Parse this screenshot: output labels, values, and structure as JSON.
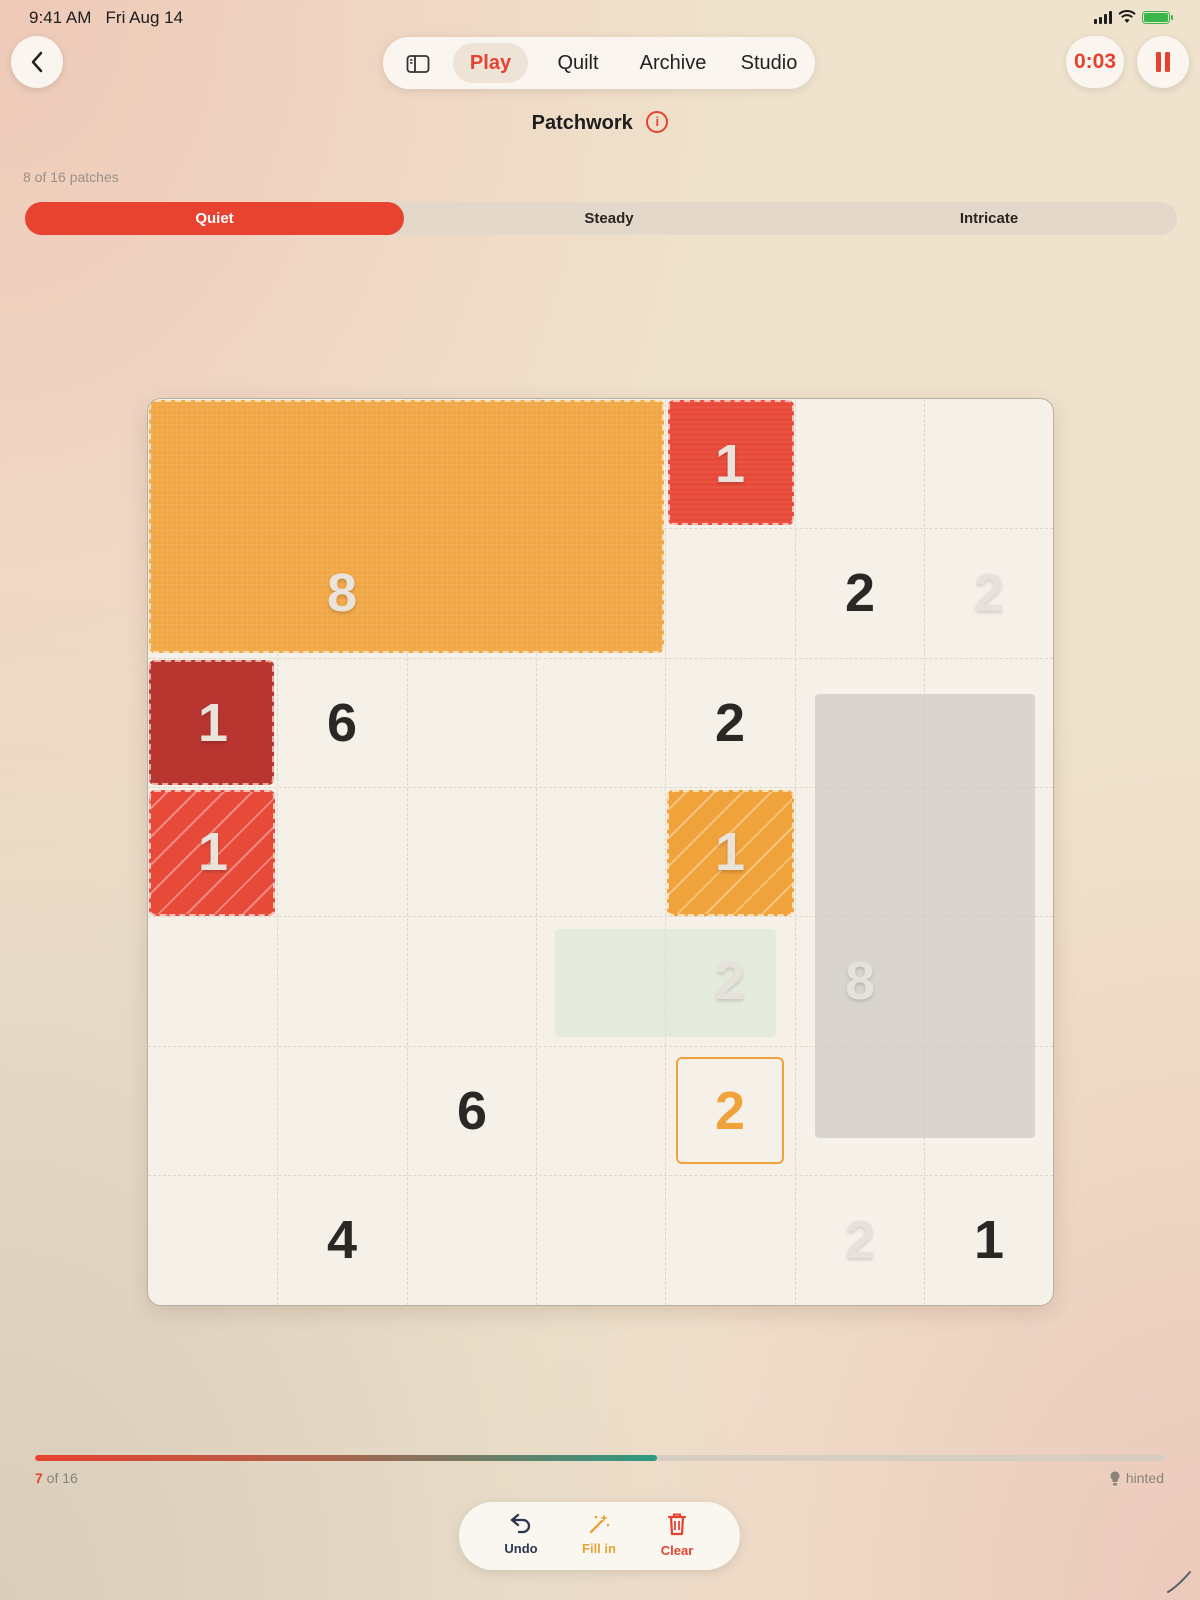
{
  "status": {
    "time": "9:41 AM",
    "date": "Fri Aug 14"
  },
  "header": {
    "tabs": [
      "Play",
      "Quilt",
      "Archive",
      "Studio"
    ],
    "active_tab": "Play",
    "timer": "0:03"
  },
  "title": "Patchwork",
  "patch_count": "8 of 16 patches",
  "difficulty": {
    "options": [
      "Quiet",
      "Steady",
      "Intricate"
    ],
    "selected": "Quiet"
  },
  "board": {
    "grid_size": 7,
    "clues": [
      {
        "row": 0,
        "col": 2,
        "value": "8",
        "style": "light"
      },
      {
        "row": 0,
        "col": 4,
        "value": "1",
        "style": "light"
      },
      {
        "row": 1,
        "col": 5,
        "value": "2",
        "style": "dark"
      },
      {
        "row": 1,
        "col": 6,
        "value": "2",
        "style": "faint"
      },
      {
        "row": 2,
        "col": 0,
        "value": "1",
        "style": "light"
      },
      {
        "row": 2,
        "col": 1,
        "value": "6",
        "style": "dark"
      },
      {
        "row": 2,
        "col": 4,
        "value": "2",
        "style": "dark"
      },
      {
        "row": 3,
        "col": 0,
        "value": "1",
        "style": "light"
      },
      {
        "row": 3,
        "col": 4,
        "value": "1",
        "style": "light"
      },
      {
        "row": 4,
        "col": 4,
        "value": "2",
        "style": "faint"
      },
      {
        "row": 4,
        "col": 5,
        "value": "8",
        "style": "faint"
      },
      {
        "row": 5,
        "col": 2,
        "value": "6",
        "style": "dark"
      },
      {
        "row": 5,
        "col": 4,
        "value": "2",
        "style": "accent"
      },
      {
        "row": 6,
        "col": 1,
        "value": "4",
        "style": "dark"
      },
      {
        "row": 6,
        "col": 5,
        "value": "2",
        "style": "faint"
      },
      {
        "row": 6,
        "col": 6,
        "value": "1",
        "style": "dark"
      }
    ],
    "colors": {
      "orange": "#f0a23b",
      "red": "#e84a3a",
      "dark_red": "#b83530",
      "accent": "#e54330"
    }
  },
  "progress": {
    "current": "7",
    "suffix": " of 16",
    "fraction": 0.55,
    "hint_label": "hinted"
  },
  "toolbar": {
    "undo": "Undo",
    "fill": "Fill in",
    "clear": "Clear"
  }
}
